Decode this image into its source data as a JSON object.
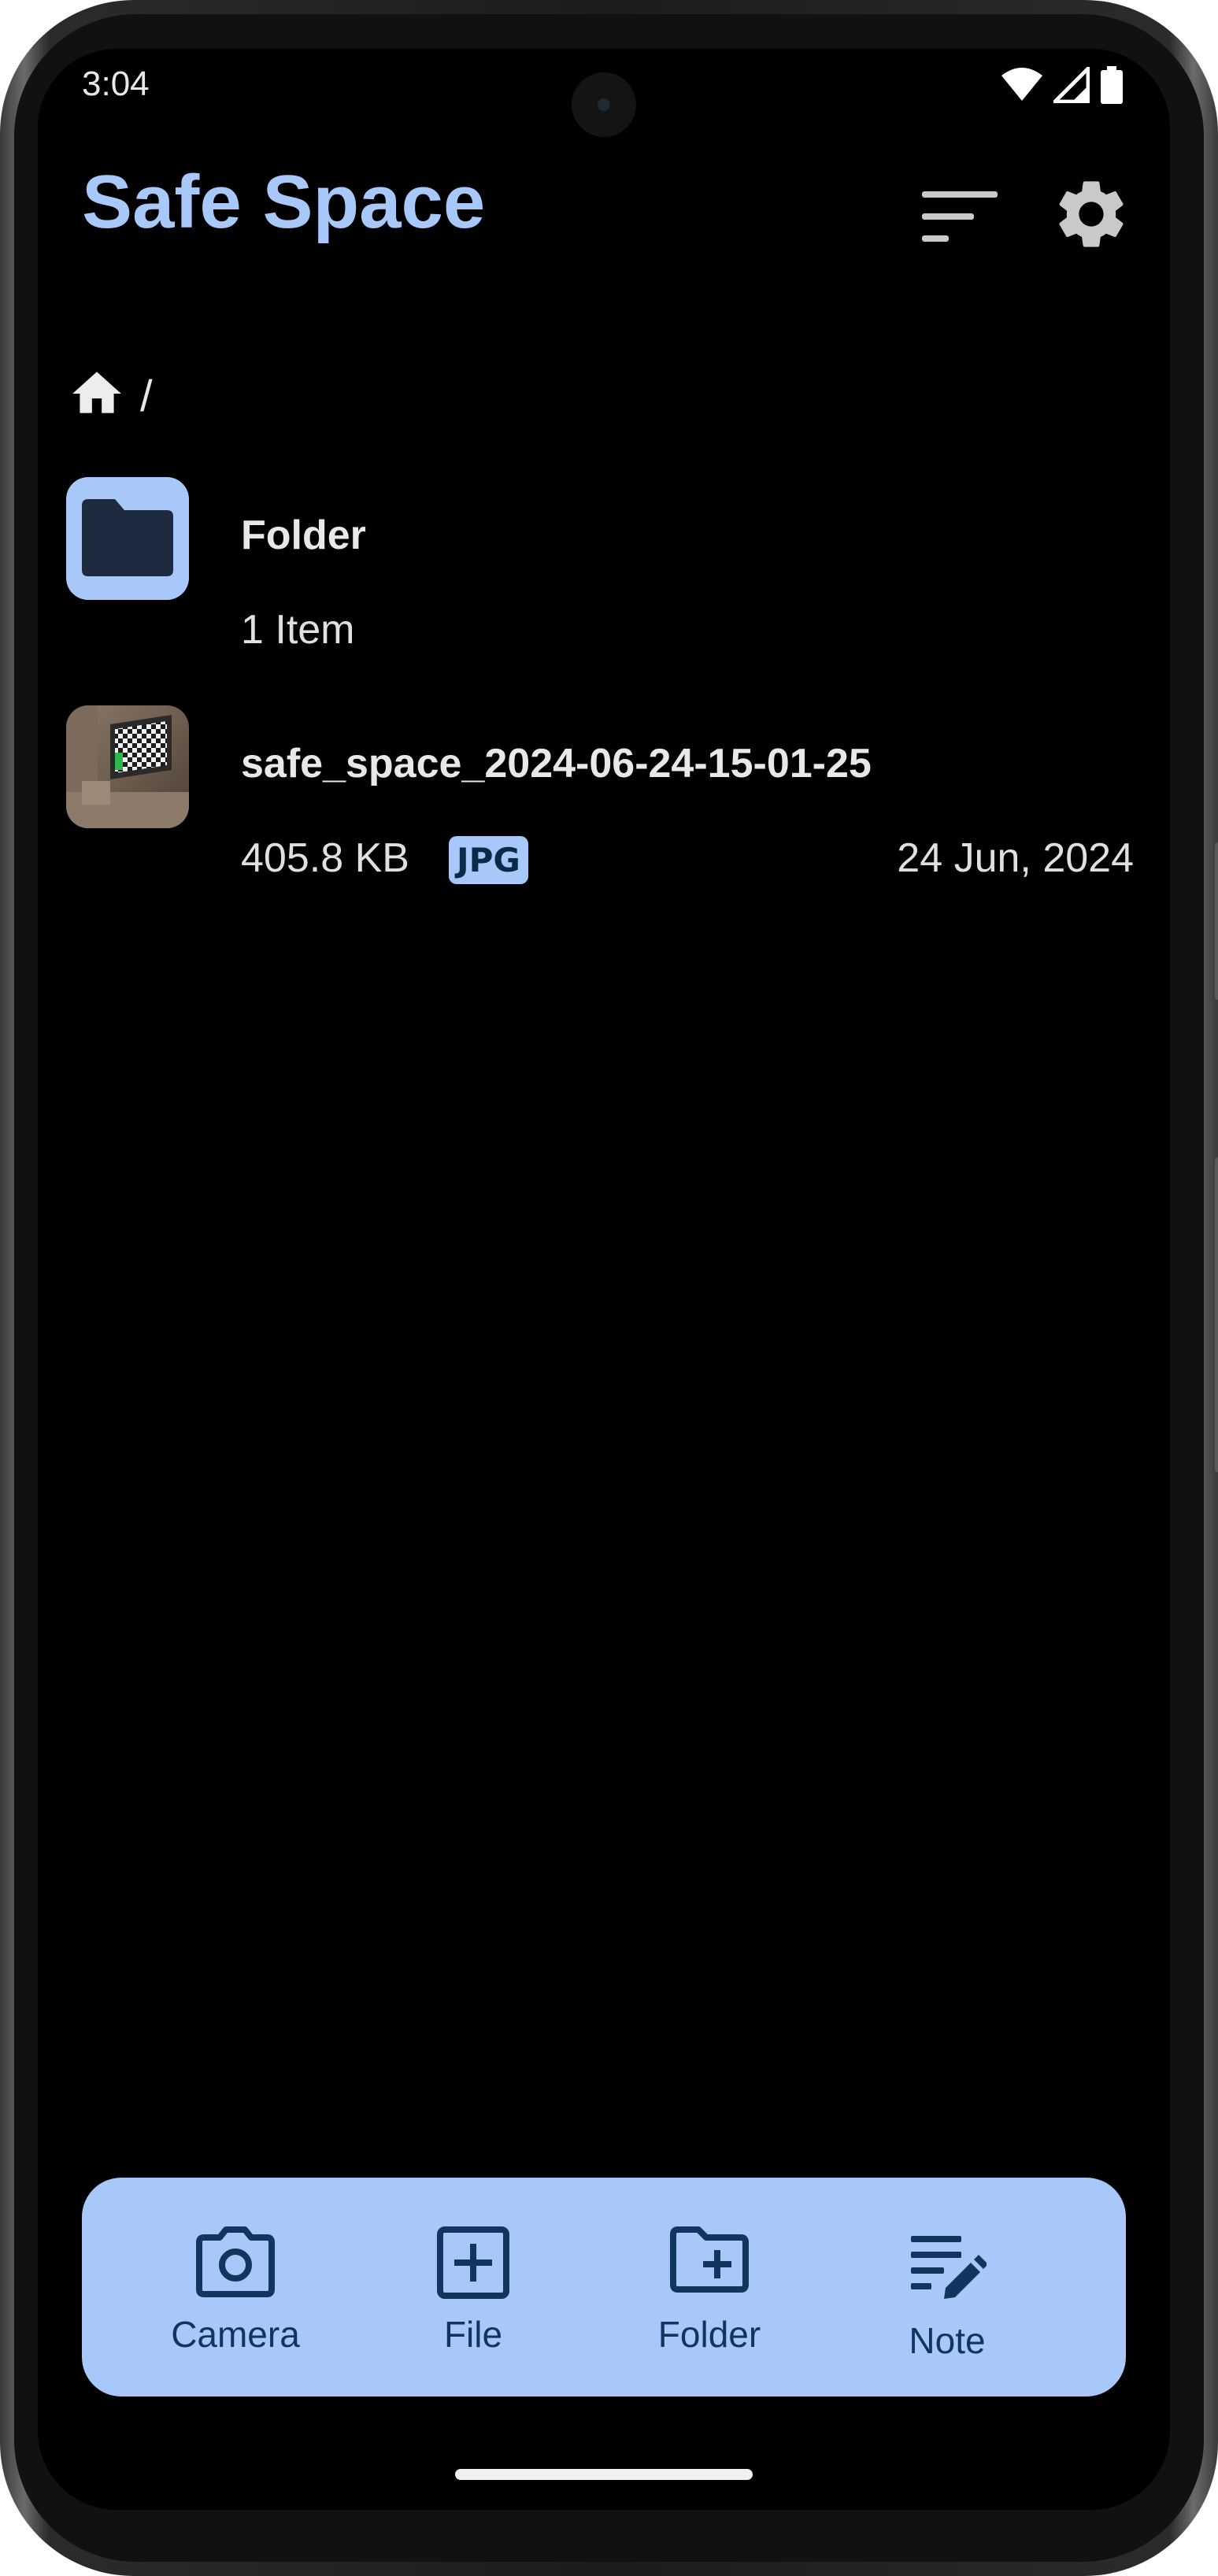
{
  "status_bar": {
    "time": "3:04",
    "icons": [
      "wifi-icon",
      "signal-icon",
      "battery-icon"
    ]
  },
  "app_bar": {
    "title": "Safe Space",
    "actions": [
      "sort-icon",
      "gear-icon"
    ]
  },
  "breadcrumb": {
    "home_icon": "home-icon",
    "separator": "/"
  },
  "items": [
    {
      "type": "folder",
      "name": "Folder",
      "meta": "1 Item",
      "icon": "folder-icon"
    },
    {
      "type": "file",
      "name": "safe_space_2024-06-24-15-01-25",
      "size": "405.8 KB",
      "badge": "JPG",
      "date": "24 Jun, 2024",
      "icon": "image-thumbnail"
    }
  ],
  "actions": [
    {
      "label": "Camera",
      "icon": "camera-icon"
    },
    {
      "label": "File",
      "icon": "add-file-icon"
    },
    {
      "label": "Folder",
      "icon": "add-folder-icon"
    },
    {
      "label": "Note",
      "icon": "edit-note-icon"
    }
  ],
  "colors": {
    "accent": "#a8c8fa",
    "background": "#000000",
    "on_accent": "#10365e",
    "text": "#e8e8e8"
  }
}
